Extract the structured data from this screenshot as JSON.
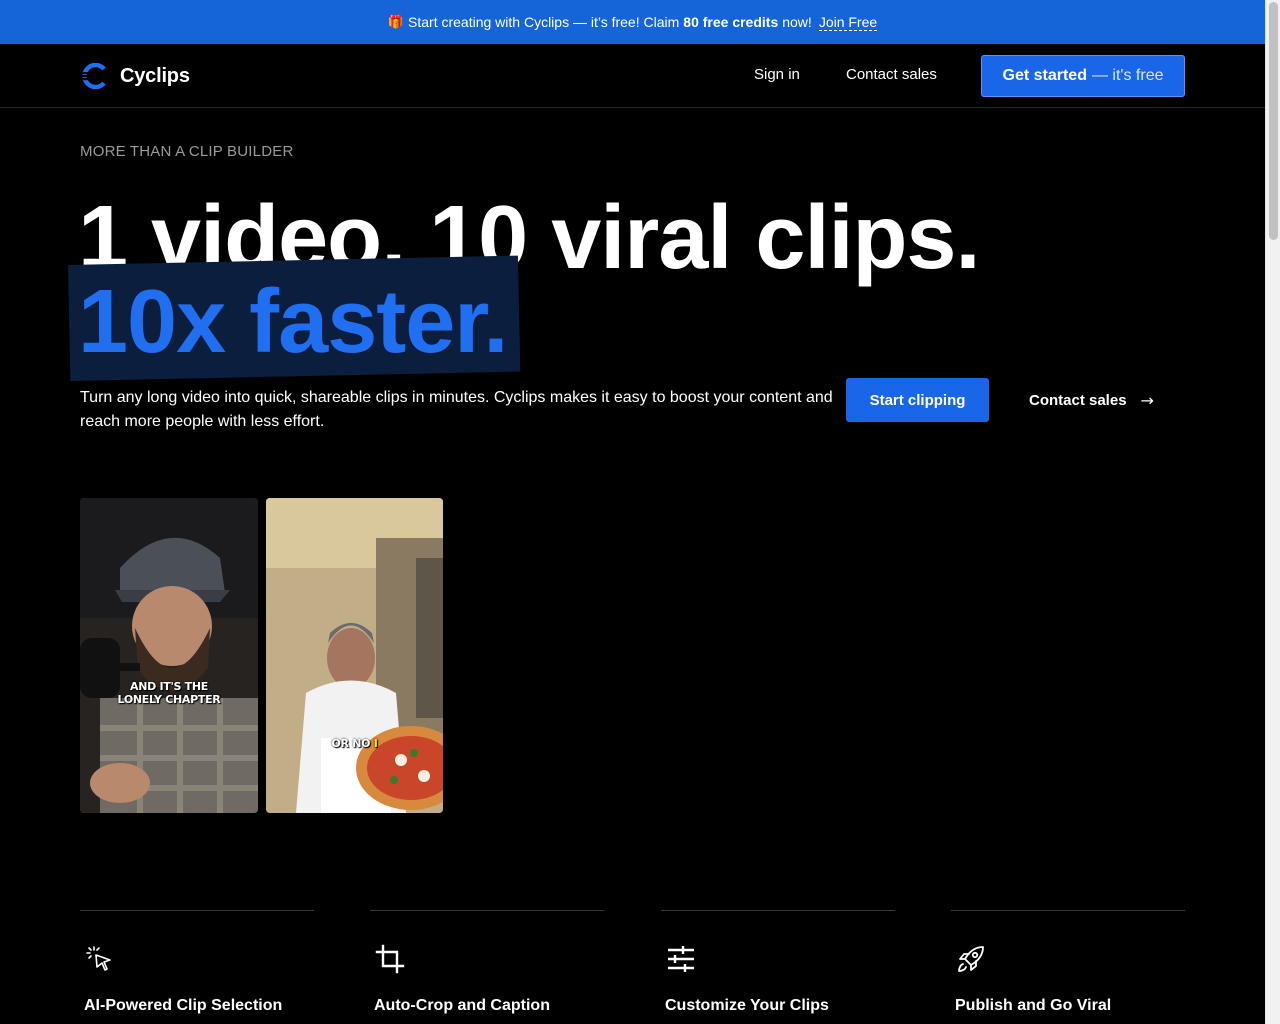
{
  "announcement": {
    "icon": "gift-icon",
    "text_before": "Start creating with Cyclips — it’s free! Claim",
    "credits": "80 free credits",
    "text_after": "now!",
    "link": "Join Free",
    "background": "#1565d8"
  },
  "header": {
    "brand": "Cyclips",
    "logo_icon": "cyclips-logo-icon",
    "nav": {
      "sign_in": "Sign in",
      "contact_sales": "Contact sales"
    },
    "cta": {
      "main": "Get started",
      "sub": "— it's free"
    }
  },
  "hero": {
    "eyebrow": "MORE THAN A CLIP BUILDER",
    "headline_line1": "1 video, 10 viral clips.",
    "headline_line2": "10x faster.",
    "description": "Turn any long video into quick, shareable clips in minutes. Cyclips makes it easy to boost your content and reach more people with less effort.",
    "primary_button": "Start clipping",
    "secondary_button": "Contact sales",
    "accent_color": "#1a66e8"
  },
  "clips": [
    {
      "caption_line1": "AND IT'S THE",
      "caption_line2": "LONELY CHAPTER"
    },
    {
      "caption_white": "OR NO",
      "caption_yellow": "I"
    }
  ],
  "features": [
    {
      "icon": "sparkle-cursor-icon",
      "title": "AI-Powered Clip Selection"
    },
    {
      "icon": "crop-icon",
      "title": "Auto-Crop and Caption"
    },
    {
      "icon": "sliders-icon",
      "title": "Customize Your Clips"
    },
    {
      "icon": "rocket-icon",
      "title": "Publish and Go Viral"
    }
  ]
}
